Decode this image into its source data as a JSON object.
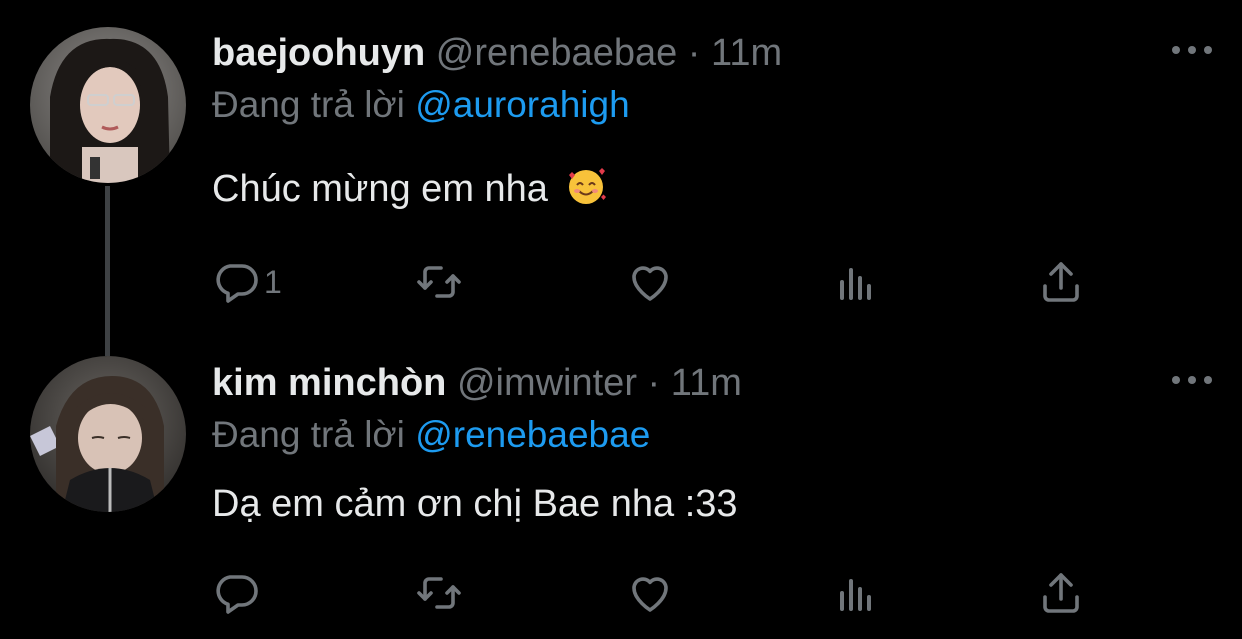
{
  "tweets": [
    {
      "display_name": "baejoohuyn",
      "handle": "@renebaebae",
      "separator": "·",
      "time": "11m",
      "reply_label": "Đang trả lời",
      "reply_mention": "@aurorahigh",
      "text": "Chúc mừng em nha",
      "emoji": "smiling-face-with-hearts",
      "reply_count": "1",
      "icons": [
        "reply-icon",
        "retweet-icon",
        "like-icon",
        "views-icon",
        "share-icon",
        "more-icon"
      ]
    },
    {
      "display_name": "kim minchòn",
      "handle": "@imwinter",
      "separator": "·",
      "time": "11m",
      "reply_label": "Đang trả lời",
      "reply_mention": "@renebaebae",
      "text": "Dạ em cảm ơn chị Bae nha :33",
      "reply_count": "",
      "icons": [
        "reply-icon",
        "retweet-icon",
        "like-icon",
        "views-icon",
        "share-icon",
        "more-icon"
      ]
    }
  ],
  "colors": {
    "background": "#000000",
    "text": "#e7e9ea",
    "muted": "#71767b",
    "mention": "#1d9bf0",
    "thread_line": "#3e4144"
  }
}
